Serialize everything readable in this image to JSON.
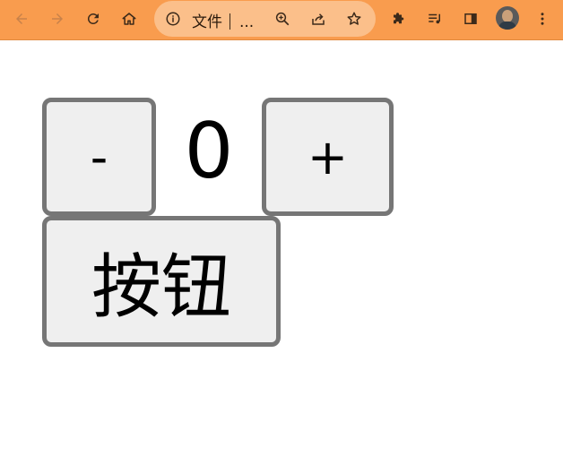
{
  "browser": {
    "address": {
      "scheme_label": "文件",
      "url_truncated": "..."
    },
    "icons": {
      "back": "back-arrow-icon",
      "forward": "forward-arrow-icon",
      "reload": "reload-icon",
      "home": "home-icon",
      "site_info": "info-icon",
      "zoom": "zoom-icon",
      "share": "share-icon",
      "bookmark": "star-icon",
      "extensions": "puzzle-icon",
      "media": "media-queue-icon",
      "side_panel": "side-panel-icon",
      "profile": "avatar",
      "menu": "more-vertical-icon"
    },
    "colors": {
      "toolbar": "#f99c4e",
      "omnibox": "#fbbf8a"
    }
  },
  "page": {
    "decrement_label": "-",
    "counter_value": "0",
    "increment_label": "+",
    "main_button_label": "按钮",
    "colors": {
      "button_bg": "#efefef",
      "button_border": "#767676"
    }
  }
}
